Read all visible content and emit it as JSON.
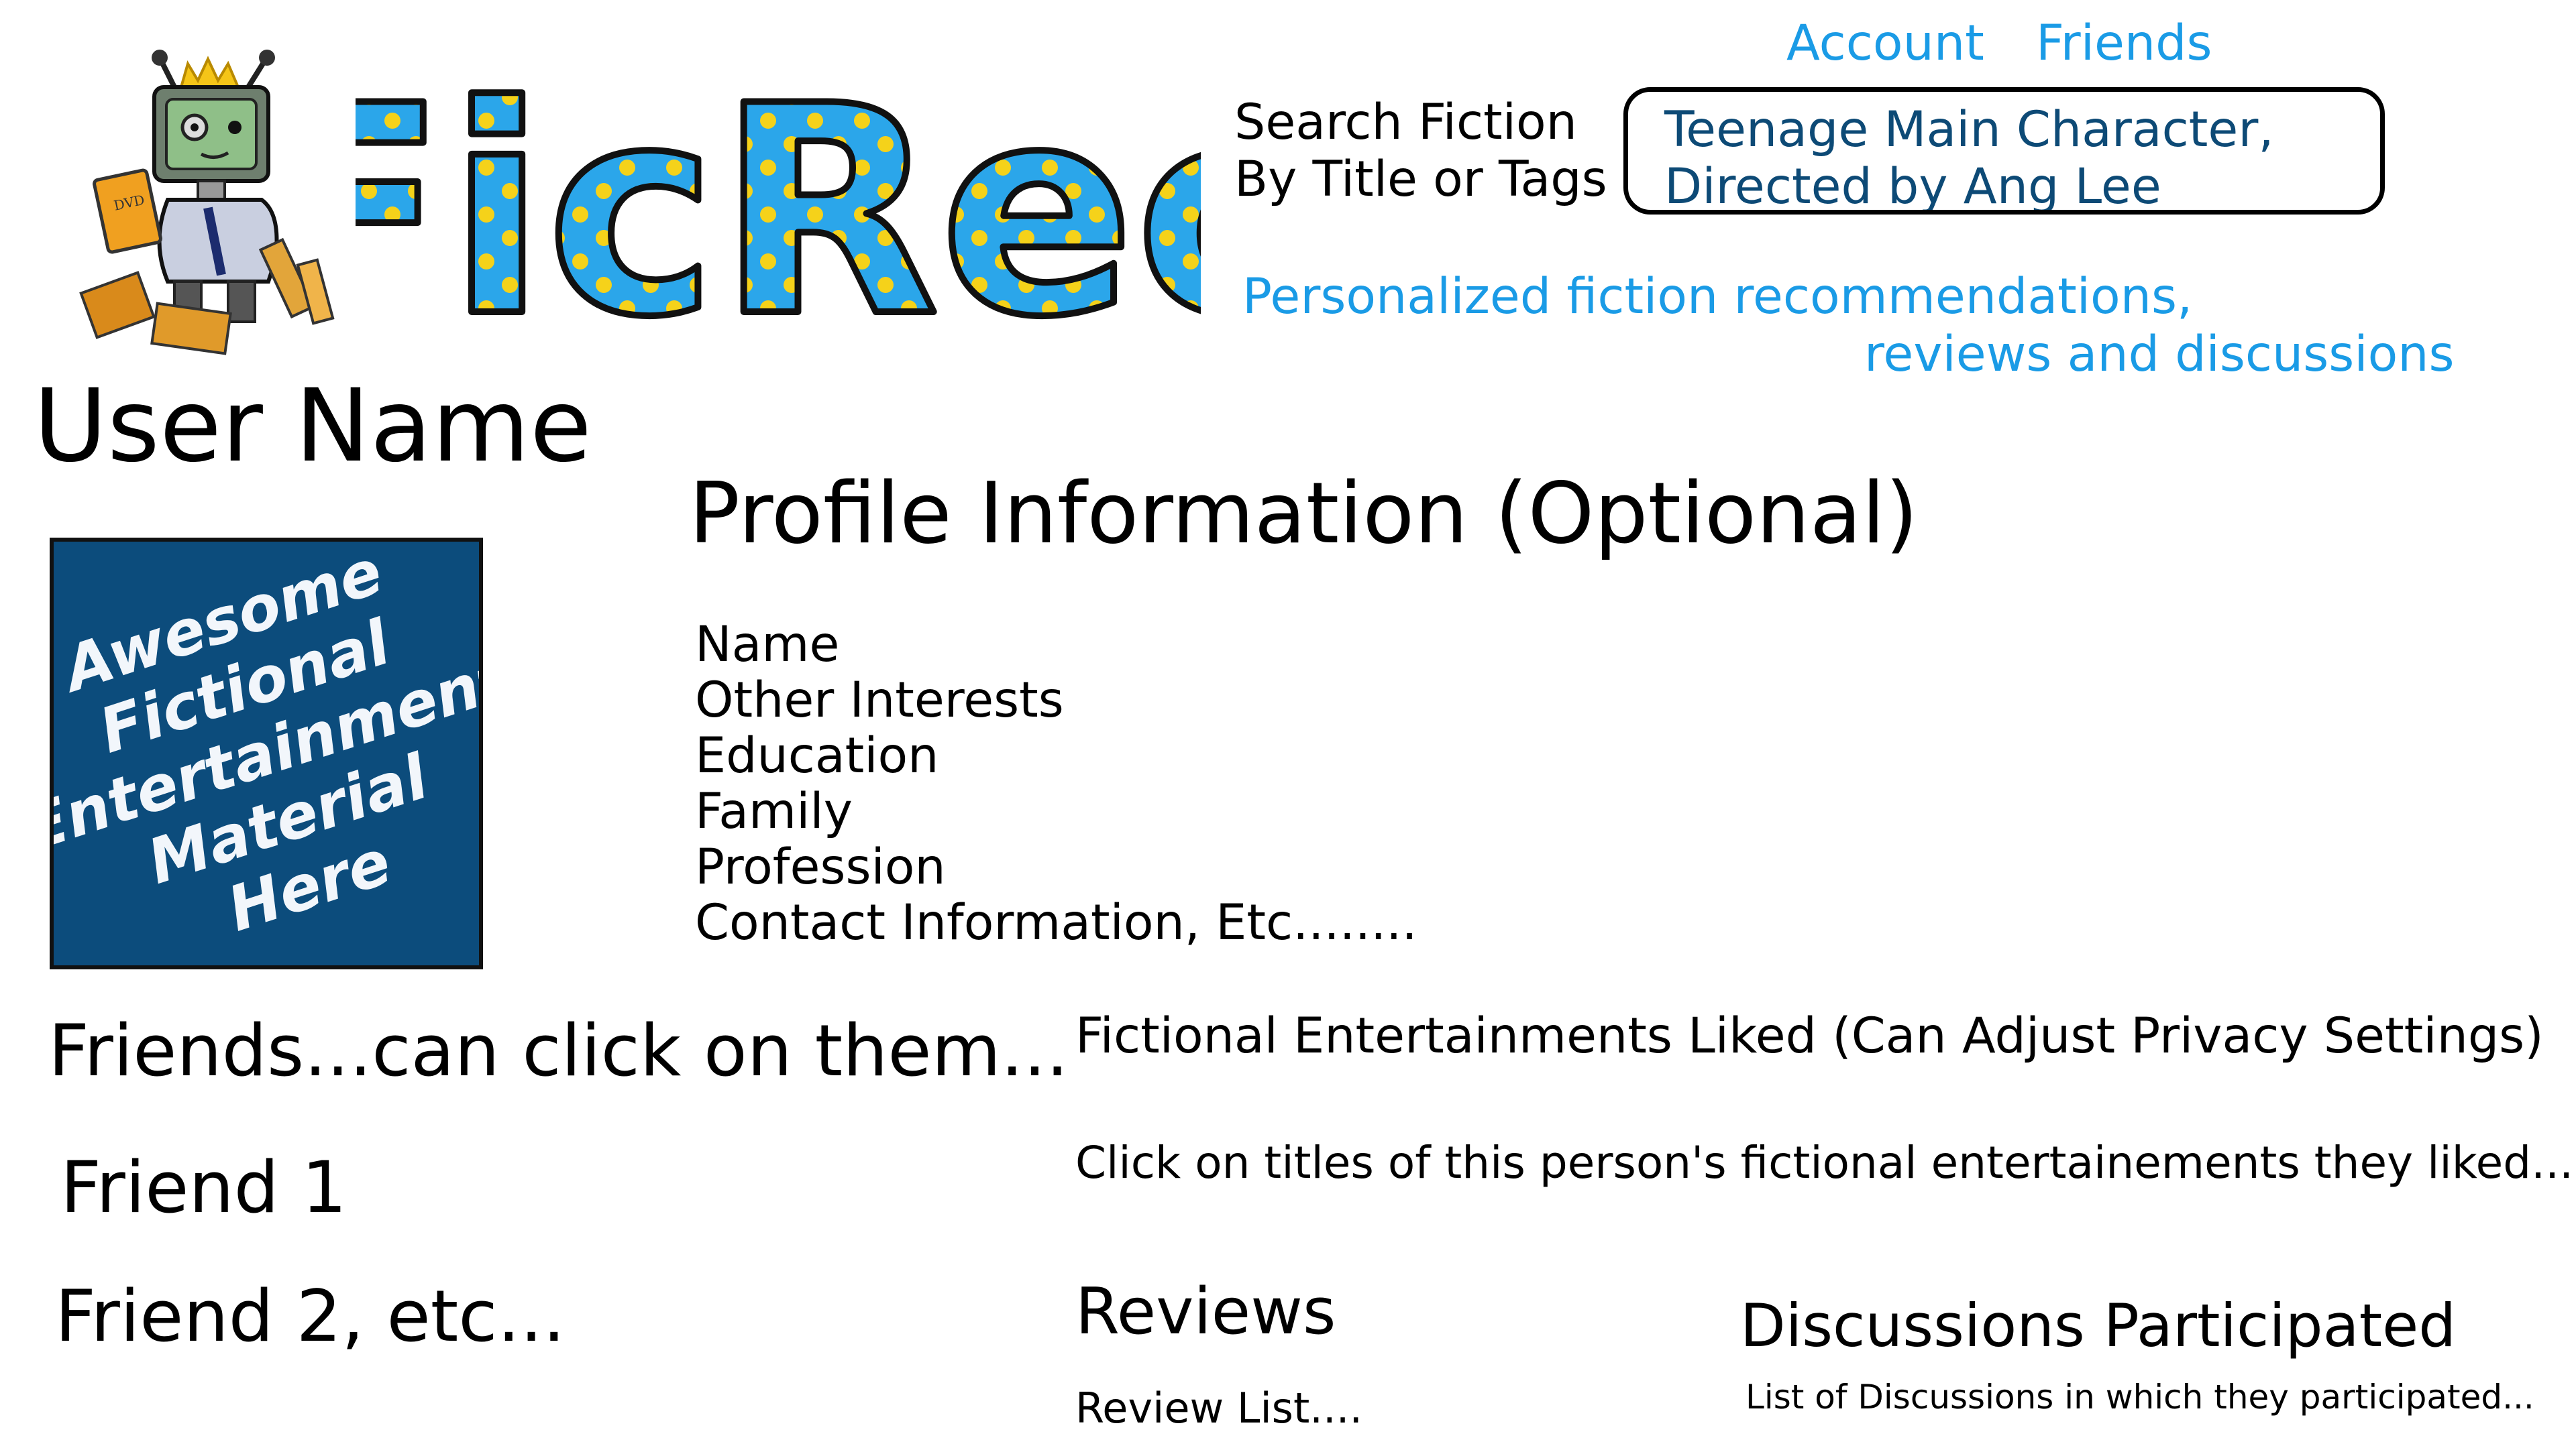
{
  "colors": {
    "link": "#1a9be6",
    "search_text": "#0d4a76",
    "tagline": "#1a9be6",
    "avatar_bg": "#0c4c7c",
    "logo_letter": "#2ba6ea",
    "logo_dot": "#f5d21a"
  },
  "logo": {
    "text": "FicRec"
  },
  "nav": {
    "account": "Account",
    "friends": "Friends"
  },
  "search": {
    "label_line1": "Search Fiction",
    "label_line2": "By Title or Tags",
    "value_line1": "Teenage Main Character,",
    "value_line2": "Directed by Ang Lee"
  },
  "tagline": {
    "line1": "Personalized fiction recommendations,",
    "line2": "reviews and discussions"
  },
  "user": {
    "name": "User Name"
  },
  "avatar": {
    "line1": "Awesome",
    "line2": "Fictional",
    "line3": "Entertainment",
    "line4": "Material",
    "line5": "Here"
  },
  "profile": {
    "title": "Profile Information (Optional)",
    "fields": [
      "Name",
      "Other Interests",
      "Education",
      "Family",
      "Profession",
      "Contact Information, Etc........"
    ]
  },
  "friends": {
    "heading": "Friends...can click on them...",
    "items": [
      "Friend 1",
      "Friend 2, etc..."
    ]
  },
  "liked": {
    "heading": "Fictional Entertainments Liked (Can Adjust  Privacy Settings)",
    "description": "Click on titles of this person's fictional entertainements they liked..."
  },
  "reviews": {
    "heading": "Reviews",
    "list": "Review List...."
  },
  "discussions": {
    "heading": "Discussions Participated",
    "list": "List of Discussions in which they participated..."
  }
}
